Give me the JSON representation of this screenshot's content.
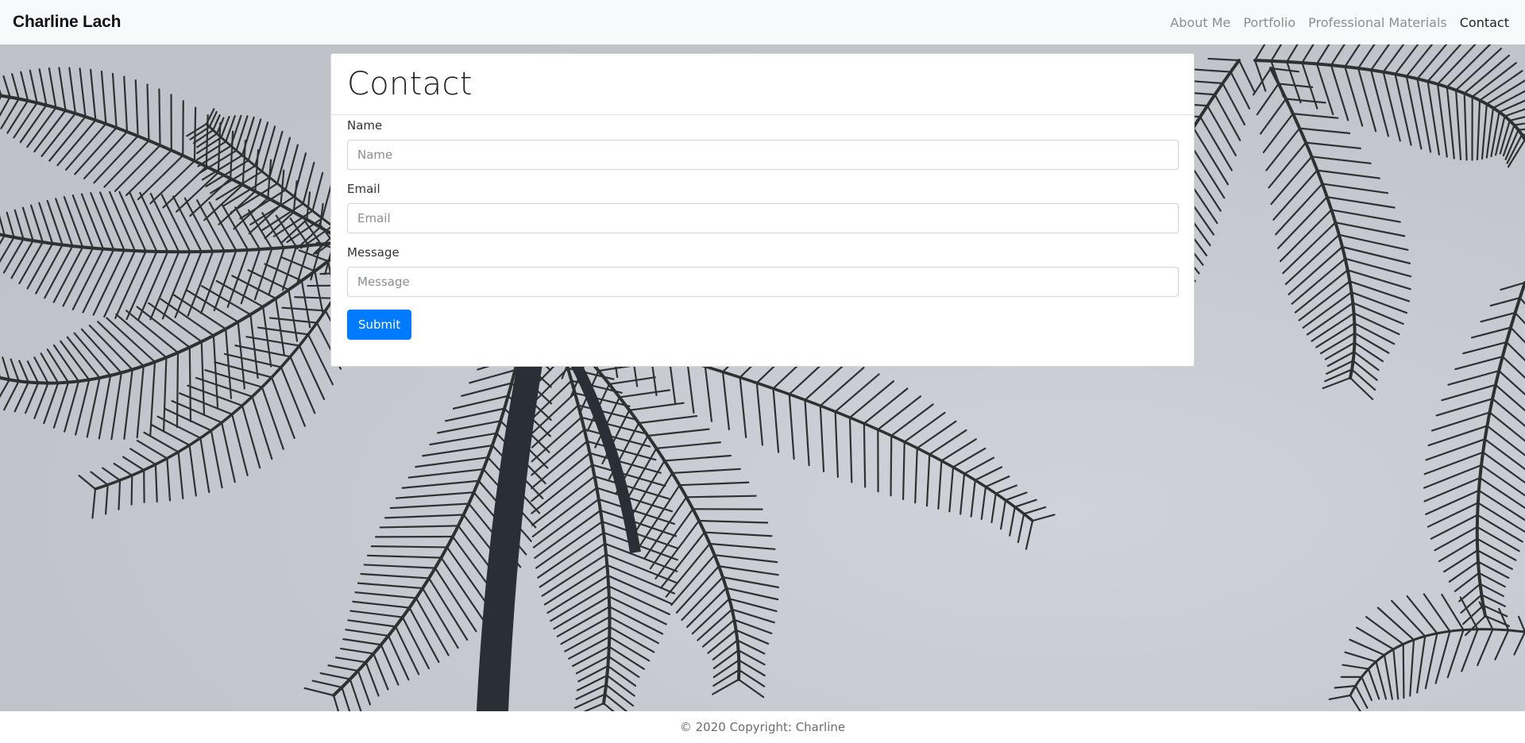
{
  "navbar": {
    "brand": "Charline Lach",
    "links": [
      {
        "label": "About Me",
        "active": false
      },
      {
        "label": "Portfolio",
        "active": false
      },
      {
        "label": "Professional Materials",
        "active": false
      },
      {
        "label": "Contact",
        "active": true
      }
    ]
  },
  "contact": {
    "title": "Contact",
    "fields": {
      "name": {
        "label": "Name",
        "placeholder": "Name",
        "value": ""
      },
      "email": {
        "label": "Email",
        "placeholder": "Email",
        "value": ""
      },
      "message": {
        "label": "Message",
        "placeholder": "Message",
        "value": ""
      }
    },
    "submit_label": "Submit"
  },
  "footer": {
    "text": "© 2020 Copyright: Charline"
  },
  "colors": {
    "navbar_bg": "#f8f9fa",
    "primary": "#007bff",
    "nav_inactive": "#8e8e8e",
    "nav_active": "#222222"
  },
  "background": {
    "icon": "palm-trees-photo"
  }
}
